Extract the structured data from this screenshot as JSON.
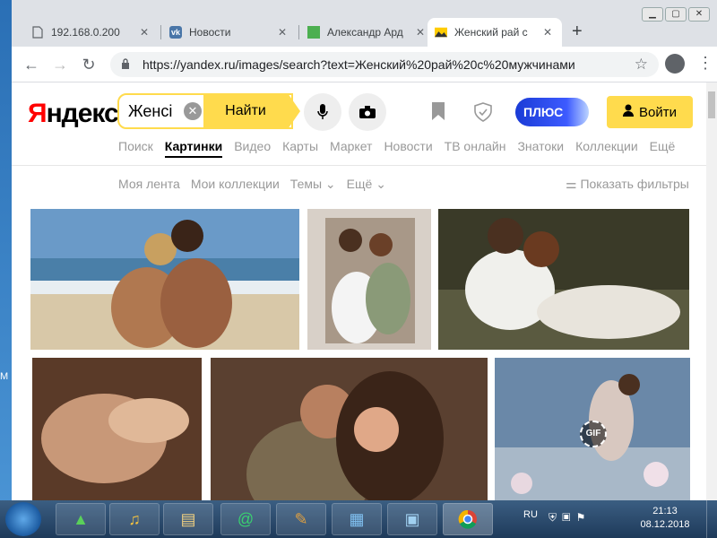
{
  "browser": {
    "tabs": [
      {
        "title": "192.168.0.200",
        "icon": "page-icon"
      },
      {
        "title": "Новости",
        "icon": "vk-icon"
      },
      {
        "title": "Александр Ард",
        "icon": "green-square-icon"
      },
      {
        "title": "Женский рай с",
        "icon": "yandex-images-icon",
        "active": true
      }
    ],
    "url": "https://yandex.ru/images/search?text=Женский%20рай%20с%20мужчинами"
  },
  "header": {
    "logo_first": "Я",
    "logo_rest": "ндекс",
    "search_value": "Женсі",
    "find_label": "Найти",
    "plus_label": "ПЛЮС",
    "login_label": "Войти"
  },
  "services": [
    "Поиск",
    "Картинки",
    "Видео",
    "Карты",
    "Маркет",
    "Новости",
    "ТВ онлайн",
    "Знатоки",
    "Коллекции",
    "Ещё"
  ],
  "subnav": [
    "Моя лента",
    "Мои коллекции",
    "Темы ⌄",
    "Ещё ⌄"
  ],
  "filters_label": "Показать фильтры",
  "gif_badge": "GIF",
  "taskbar": {
    "lang": "RU",
    "time": "21:13",
    "date": "08.12.2018"
  },
  "edge_text": "M",
  "colors": {
    "accent": "#ffdb4d",
    "plus": "#1a3bd6",
    "logo_red": "#ff0000"
  }
}
